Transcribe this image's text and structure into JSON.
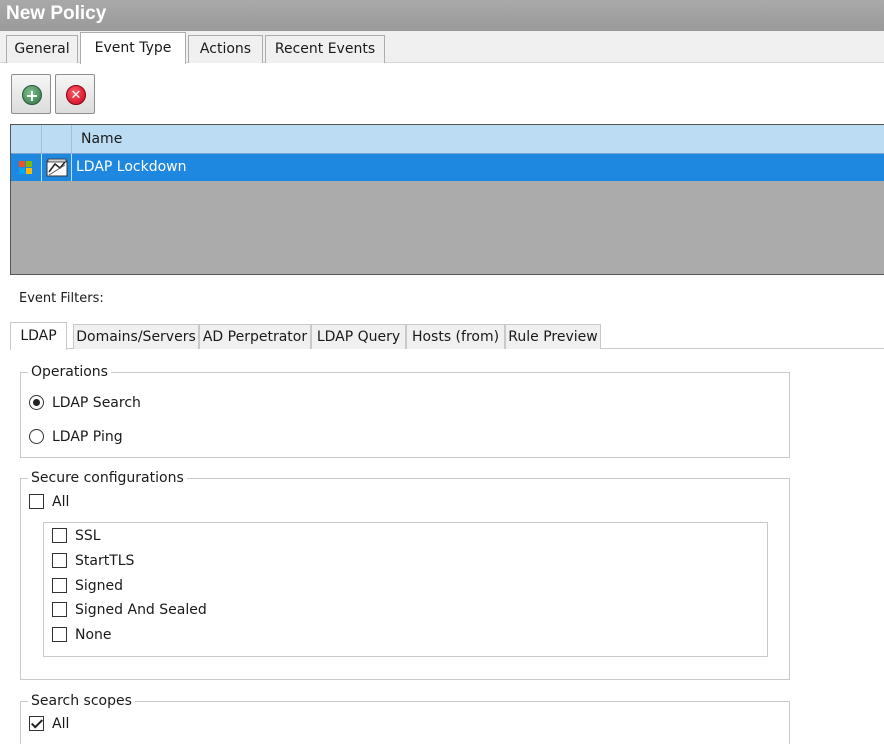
{
  "window": {
    "title": "New Policy"
  },
  "tabs": [
    {
      "label": "General",
      "active": false
    },
    {
      "label": "Event Type",
      "active": true
    },
    {
      "label": "Actions",
      "active": false
    },
    {
      "label": "Recent Events",
      "active": false
    }
  ],
  "toolbar": {
    "add_icon": "add-circle-icon",
    "remove_icon": "remove-circle-icon"
  },
  "grid": {
    "columns": [
      "",
      "",
      "Name"
    ],
    "rows": [
      {
        "os_icon": "windows-logo-icon",
        "type_icon": "event-type-icon",
        "name": "LDAP Lockdown",
        "selected": true
      }
    ]
  },
  "event_filters": {
    "label": "Event Filters:",
    "tabs": [
      {
        "label": "LDAP",
        "active": true
      },
      {
        "label": "Domains/Servers",
        "active": false
      },
      {
        "label": "AD Perpetrator",
        "active": false
      },
      {
        "label": "LDAP Query",
        "active": false
      },
      {
        "label": "Hosts (from)",
        "active": false
      },
      {
        "label": "Rule Preview",
        "active": false
      }
    ]
  },
  "operations": {
    "title": "Operations",
    "options": [
      {
        "label": "LDAP Search",
        "selected": true
      },
      {
        "label": "LDAP Ping",
        "selected": false
      }
    ]
  },
  "secure_configurations": {
    "title": "Secure configurations",
    "all": {
      "label": "All",
      "checked": false
    },
    "items": [
      {
        "label": "SSL",
        "checked": false
      },
      {
        "label": "StartTLS",
        "checked": false
      },
      {
        "label": "Signed",
        "checked": false
      },
      {
        "label": "Signed And Sealed",
        "checked": false
      },
      {
        "label": "None",
        "checked": false
      }
    ]
  },
  "search_scopes": {
    "title": "Search scopes",
    "all": {
      "label": "All",
      "checked": true
    }
  },
  "colors": {
    "titlebar": "#9f9f9f",
    "grid_header": "#bcdcf4",
    "selected_row": "#1e88e0",
    "grid_body": "#ababab"
  }
}
